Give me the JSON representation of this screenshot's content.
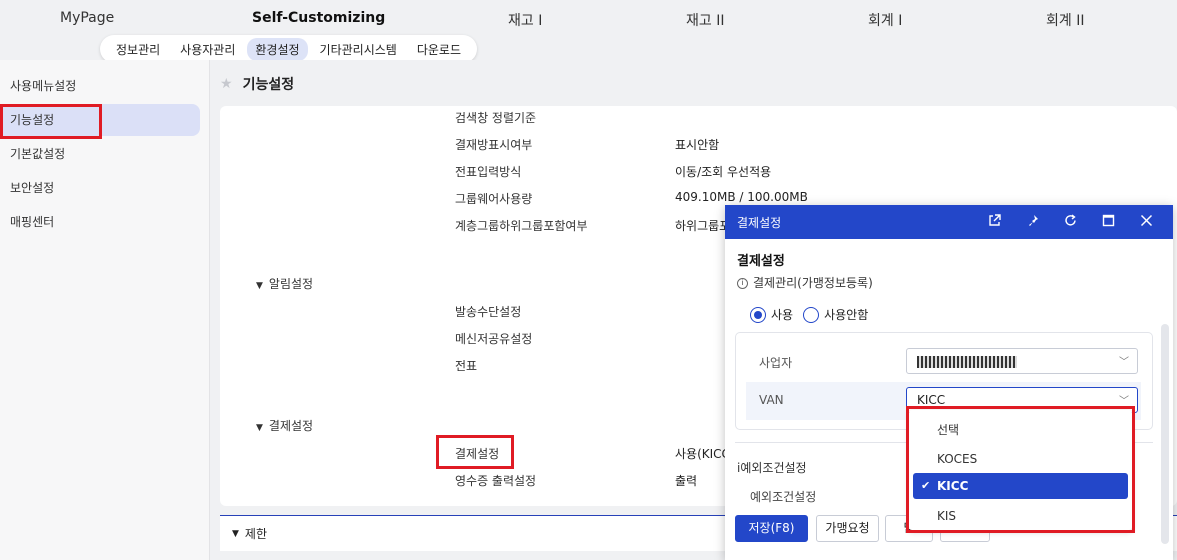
{
  "topnav": {
    "items": [
      {
        "label": "MyPage"
      },
      {
        "label": "Self-Customizing",
        "active": true
      },
      {
        "label": "재고 I"
      },
      {
        "label": "재고 II"
      },
      {
        "label": "회계 I"
      },
      {
        "label": "회계 II"
      }
    ],
    "sub": [
      {
        "label": "정보관리"
      },
      {
        "label": "사용자관리"
      },
      {
        "label": "환경설정",
        "active": true
      },
      {
        "label": "기타관리시스템"
      },
      {
        "label": "다운로드"
      }
    ]
  },
  "sidebar": {
    "items": [
      {
        "label": "사용메뉴설정"
      },
      {
        "label": "기능설정",
        "active": true
      },
      {
        "label": "기본값설정"
      },
      {
        "label": "보안설정"
      },
      {
        "label": "매핑센터"
      }
    ]
  },
  "page": {
    "title": "기능설정"
  },
  "settings": {
    "rows": [
      {
        "label": "검색창 정렬기준",
        "value": ""
      },
      {
        "label": "결재방표시여부",
        "value": "표시안함"
      },
      {
        "label": "전표입력방식",
        "value": "이동/조회 우선적용"
      },
      {
        "label": "그룹웨어사용량",
        "value": "409.10MB / 100.00MB"
      },
      {
        "label": "계층그룹하위그룹포함여부",
        "value": "하위그룹포"
      }
    ],
    "group_alert": "알림설정",
    "alert_rows": [
      {
        "label": "발송수단설정"
      },
      {
        "label": "메신저공유설정"
      },
      {
        "label": "전표"
      }
    ],
    "group_payment": "결제설정",
    "payment_rows": [
      {
        "label": "결제설정",
        "value": "사용(KICC)"
      },
      {
        "label": "영수증 출력설정",
        "value": "출력"
      }
    ],
    "limit_group": "제한"
  },
  "modal": {
    "header": "결제설정",
    "title": "결제설정",
    "section1": "결제관리(가맹정보등록)",
    "radio_use": "사용",
    "radio_not_use": "사용안함",
    "biz_label": "사업자",
    "van_label": "VAN",
    "van_value": "KICC",
    "section2": "예외조건설정",
    "section2_sub": "예외조건설정",
    "btn_save": "저장(F8)",
    "btn_request": "가맹요청",
    "btn_close": "닫"
  },
  "dropdown": {
    "options": [
      {
        "label": "선택"
      },
      {
        "label": "KOCES"
      },
      {
        "label": "KICC",
        "selected": true
      },
      {
        "label": "KIS"
      }
    ]
  },
  "colors": {
    "accent": "#2347c9",
    "highlight_box": "#e01b24",
    "active_bg": "#dbe0f7"
  }
}
